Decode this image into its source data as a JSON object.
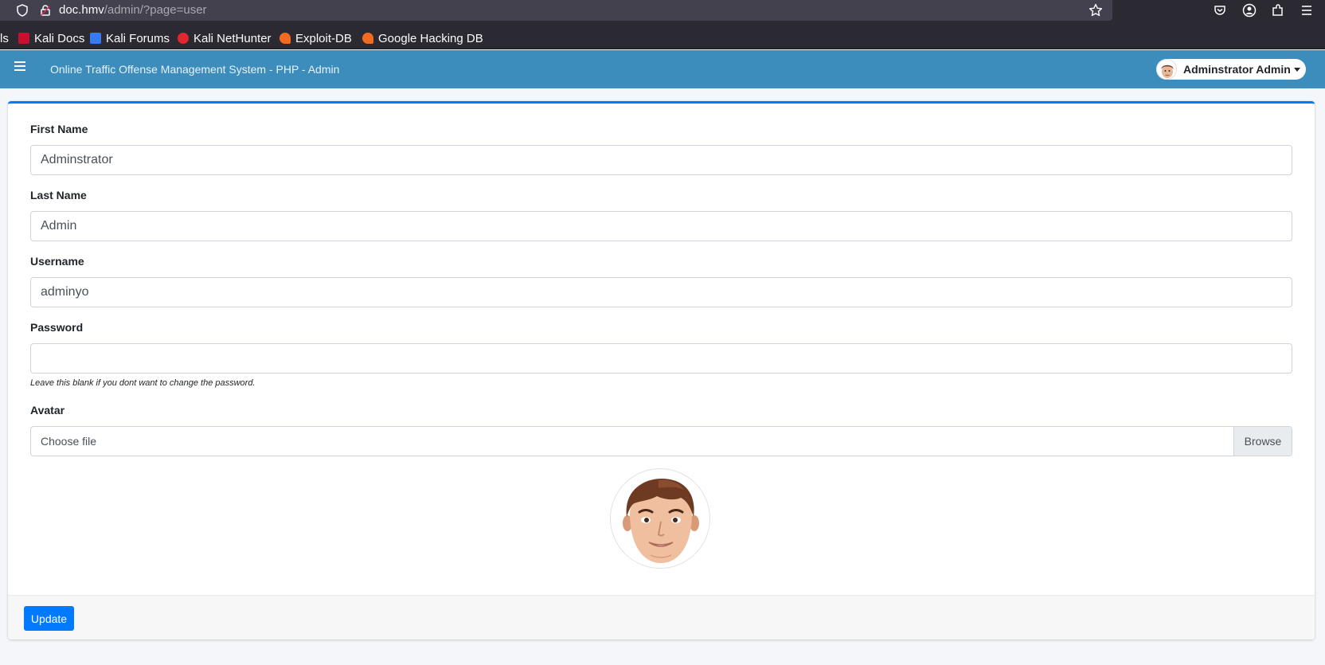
{
  "browser": {
    "url_host": "doc.hmv",
    "url_path": "/admin/?page=user",
    "bookmarks": [
      {
        "label": "ls"
      },
      {
        "label": "Kali Docs"
      },
      {
        "label": "Kali Forums"
      },
      {
        "label": "Kali NetHunter"
      },
      {
        "label": "Exploit-DB"
      },
      {
        "label": "Google Hacking DB"
      }
    ]
  },
  "navbar": {
    "title": "Online Traffic Offense Management System - PHP - Admin",
    "user_name": "Adminstrator Admin"
  },
  "form": {
    "first_name": {
      "label": "First Name",
      "value": "Adminstrator"
    },
    "last_name": {
      "label": "Last Name",
      "value": "Admin"
    },
    "username": {
      "label": "Username",
      "value": "adminyo"
    },
    "password": {
      "label": "Password",
      "value": "",
      "hint": "Leave this blank if you dont want to change the password."
    },
    "avatar": {
      "label": "Avatar",
      "file_text": "Choose file",
      "browse_label": "Browse"
    }
  },
  "footer": {
    "update_label": "Update"
  },
  "colors": {
    "navbar": "#3c8dbc",
    "primary": "#007bff",
    "browser_chrome": "#2b2a33"
  }
}
